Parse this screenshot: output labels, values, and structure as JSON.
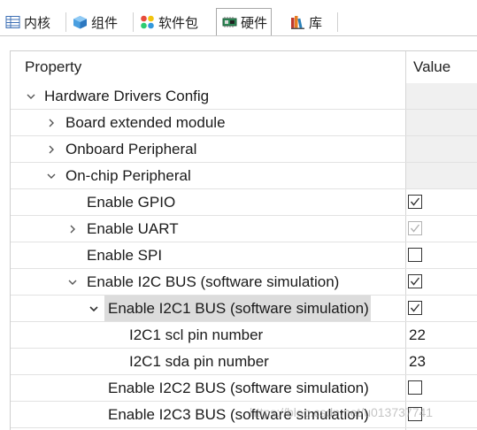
{
  "tabs": [
    {
      "label": "内核",
      "icon": "kernel-grid-icon",
      "active": false
    },
    {
      "label": "组件",
      "icon": "component-cube-icon",
      "active": false
    },
    {
      "label": "软件包",
      "icon": "packages-dots-icon",
      "active": false
    },
    {
      "label": "硬件",
      "icon": "hardware-chip-icon",
      "active": true
    },
    {
      "label": "库",
      "icon": "library-books-icon",
      "active": false
    }
  ],
  "columns": {
    "property": "Property",
    "value": "Value"
  },
  "rows": [
    {
      "label": "Hardware Drivers Config",
      "expander": "down",
      "value_type": "none"
    },
    {
      "label": "Board extended module",
      "expander": "right",
      "value_type": "none"
    },
    {
      "label": "Onboard Peripheral",
      "expander": "right",
      "value_type": "none"
    },
    {
      "label": "On-chip Peripheral",
      "expander": "down",
      "value_type": "none"
    },
    {
      "label": "Enable GPIO",
      "expander": "",
      "value_type": "checkbox",
      "checked": true
    },
    {
      "label": "Enable UART",
      "expander": "right",
      "value_type": "checkbox",
      "checked": true,
      "disabled": true
    },
    {
      "label": "Enable SPI",
      "expander": "",
      "value_type": "checkbox",
      "checked": false
    },
    {
      "label": "Enable I2C BUS (software simulation)",
      "expander": "down",
      "value_type": "checkbox",
      "checked": true
    },
    {
      "label": "Enable I2C1 BUS (software simulation)",
      "expander": "down",
      "value_type": "checkbox",
      "checked": true,
      "selected": true
    },
    {
      "label": "I2C1 scl pin number",
      "expander": "",
      "value_type": "text",
      "value": "22"
    },
    {
      "label": "I2C1 sda pin number",
      "expander": "",
      "value_type": "text",
      "value": "23"
    },
    {
      "label": "Enable I2C2 BUS (software simulation)",
      "expander": "",
      "value_type": "checkbox",
      "checked": false
    },
    {
      "label": "Enable I2C3 BUS (software simulation)",
      "expander": "",
      "value_type": "checkbox",
      "checked": false
    }
  ],
  "watermark": "https://blog.csdn.net/u013737741",
  "colors": {
    "selected_row": "#dcdcdc",
    "grey_cell": "#f0f0f0",
    "grid": "#e2e2e2"
  }
}
